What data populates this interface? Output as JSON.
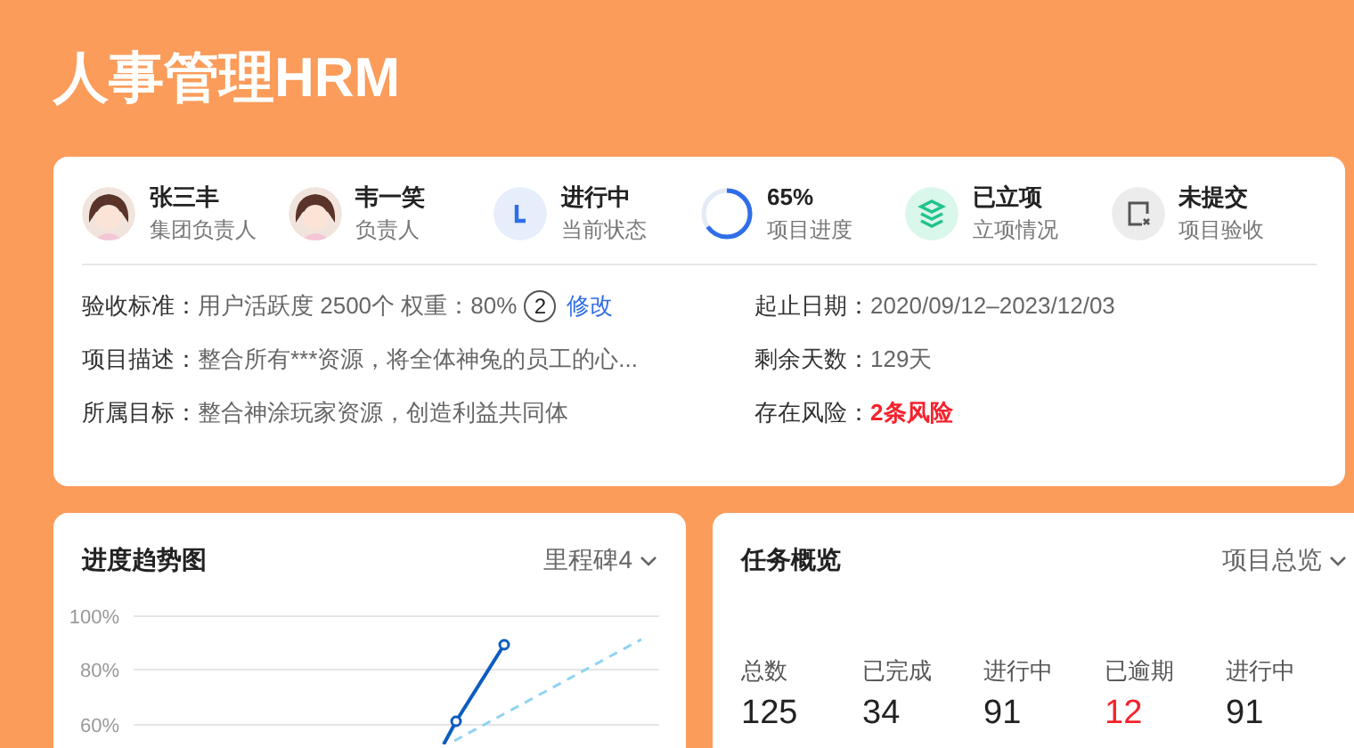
{
  "app_title": "人事管理HRM",
  "summary": [
    {
      "kind": "avatar",
      "title": "张三丰",
      "caption": "集团负责人"
    },
    {
      "kind": "avatar",
      "title": "韦一笑",
      "caption": "负责人"
    },
    {
      "kind": "clock",
      "title": "进行中",
      "caption": "当前状态"
    },
    {
      "kind": "ring",
      "title": "65%",
      "caption": "项目进度",
      "level": 0.65
    },
    {
      "kind": "layers",
      "title": "已立项",
      "caption": "立项情况"
    },
    {
      "kind": "document",
      "title": "未提交",
      "caption": "项目验收"
    }
  ],
  "details_left": [
    {
      "label": "验收标准：",
      "value": "用户活跃度  2500个  权重：80%",
      "badge": "2",
      "link": "修改"
    },
    {
      "label": "项目描述：",
      "value": "整合所有***资源，将全体神兔的员工的心..."
    },
    {
      "label": "所属目标：",
      "value": "整合神涂玩家资源，创造利益共同体"
    }
  ],
  "details_right": [
    {
      "label": "起止日期：",
      "value": "2020/09/12–2023/12/03",
      "warning": false
    },
    {
      "label": "剩余天数：",
      "value": "129天",
      "warning": false
    },
    {
      "label": "存在风险：",
      "value": "2条风险",
      "warning": true
    }
  ],
  "trend_panel": {
    "title": "进度趋势图",
    "dropdown": "里程碑4",
    "y_axis_labels": [
      "100%",
      "80%",
      "60%"
    ]
  },
  "task_panel": {
    "title": "任务概览",
    "dropdown": "项目总览",
    "stats": [
      {
        "label": "总数",
        "value": "125",
        "overdue": false
      },
      {
        "label": "已完成",
        "value": "34",
        "overdue": false
      },
      {
        "label": "进行中",
        "value": "91",
        "overdue": false
      },
      {
        "label": "已逾期",
        "value": "12",
        "overdue": true
      },
      {
        "label": "进行中",
        "value": "91",
        "overdue": false
      }
    ]
  }
}
